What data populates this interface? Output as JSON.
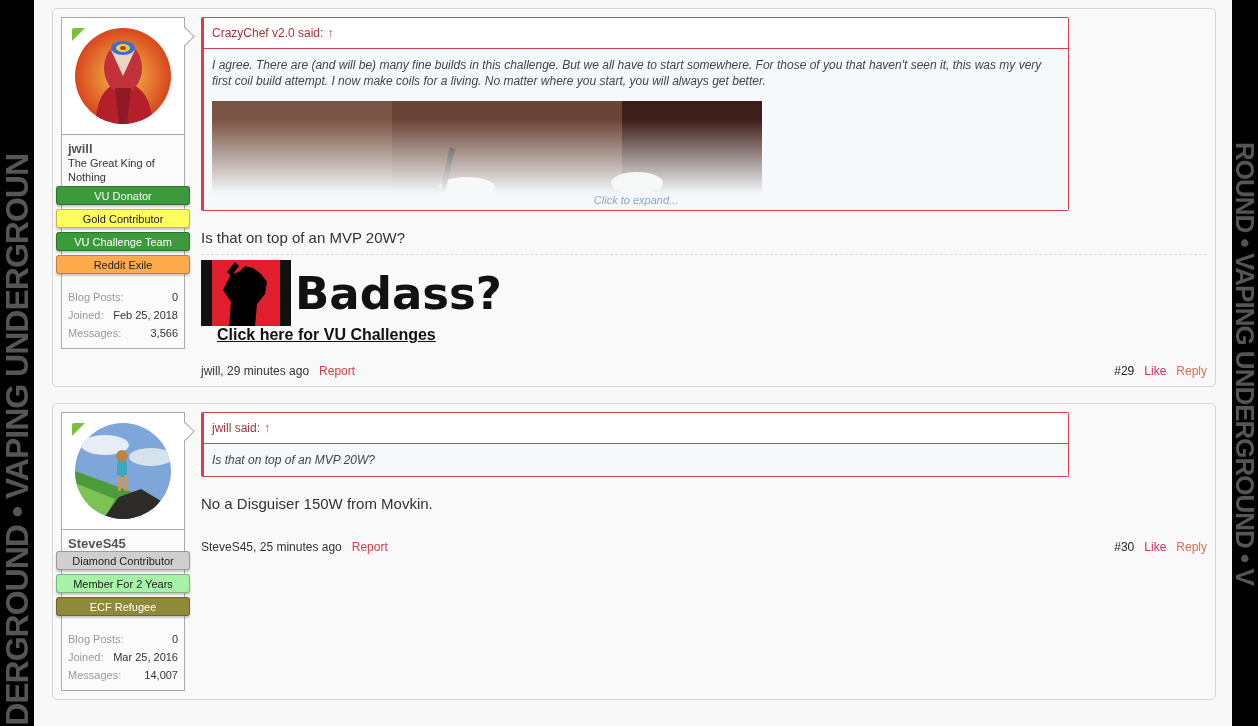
{
  "side_banners": {
    "left": "DERGROUND • VAPING UNDERGROUN",
    "right": "ROUND • VAPING UNDERGROUND • V"
  },
  "posts": [
    {
      "user": {
        "name": "jwill",
        "title": "The Great King of Nothing",
        "online": true,
        "banners": [
          {
            "label": "VU Donator",
            "color": "#3c9a3c"
          },
          {
            "label": "Gold Contributor",
            "color": "#fdfd5c"
          },
          {
            "label": "VU Challenge Team",
            "color": "#3c9a3c"
          },
          {
            "label": "Reddit Exile",
            "color": "#fdab4c"
          }
        ],
        "stats": [
          {
            "label": "Blog Posts:",
            "value": "0"
          },
          {
            "label": "Joined:",
            "value": "Feb 25, 2018"
          },
          {
            "label": "Messages:",
            "value": "3,566"
          }
        ]
      },
      "quote": {
        "author": "CrazyChef v2.0 said:",
        "arrow": "↑",
        "text": "I agree. There are (and will be) many fine builds in this challenge. But we all have to start somewhere. For those of you that haven't seen it, this was my very first coil build attempt. I now make coils for a living. No matter where you start, you will always get better.",
        "expand": "Click to expand..."
      },
      "message": "Is that on top of an MVP 20W?",
      "signature": {
        "headline": "Badass?",
        "link": "Click here for VU Challenges"
      },
      "byline": "jwill, 29 minutes ago",
      "report": "Report",
      "number": "#29",
      "like": "Like",
      "reply": "Reply"
    },
    {
      "user": {
        "name": "SteveS45",
        "online": true,
        "banners": [
          {
            "label": "Diamond Contributor",
            "color": "#cfcfcf"
          },
          {
            "label": "Member For 2 Years",
            "color": "#a6f2a6"
          },
          {
            "label": "ECF Refugee",
            "color": "#8e8a3a"
          }
        ],
        "stats": [
          {
            "label": "Blog Posts:",
            "value": "0"
          },
          {
            "label": "Joined:",
            "value": "Mar 25, 2016"
          },
          {
            "label": "Messages:",
            "value": "14,007"
          }
        ]
      },
      "quote": {
        "author": "jwill said:",
        "arrow": "↑",
        "text": "Is that on top of an MVP 20W?"
      },
      "message": "No a Disguiser 150W from Movkin.",
      "byline": "SteveS45, 25 minutes ago",
      "report": "Report",
      "number": "#30",
      "like": "Like",
      "reply": "Reply"
    }
  ]
}
